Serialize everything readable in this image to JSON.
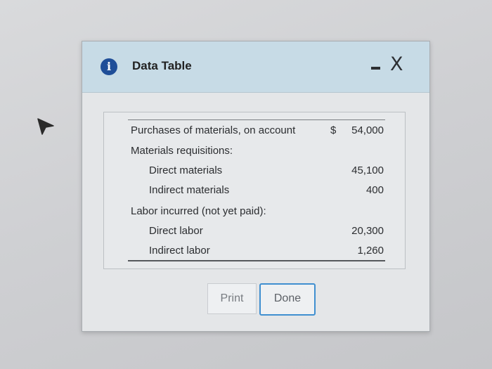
{
  "dialog": {
    "title": "Data Table",
    "icon": "info-icon",
    "close_glyph": "X"
  },
  "table": {
    "rows": [
      {
        "label": "Purchases of materials, on account",
        "currency": "$",
        "amount": "54,000",
        "indent": 0
      },
      {
        "label": "Materials requisitions:",
        "currency": "",
        "amount": "",
        "indent": 0
      },
      {
        "label": "Direct materials",
        "currency": "",
        "amount": "45,100",
        "indent": 1
      },
      {
        "label": "Indirect materials",
        "currency": "",
        "amount": "400",
        "indent": 1
      },
      {
        "label": "Labor incurred (not yet paid):",
        "currency": "",
        "amount": "",
        "indent": 0
      },
      {
        "label": "Direct labor",
        "currency": "",
        "amount": "20,300",
        "indent": 1
      },
      {
        "label": "Indirect labor",
        "currency": "",
        "amount": "1,260",
        "indent": 1
      }
    ]
  },
  "buttons": {
    "print_label": "Print",
    "done_label": "Done"
  },
  "colors": {
    "titlebar": "#c7dbe6",
    "info_icon": "#1f4e98",
    "done_border": "#3f8fd0"
  }
}
